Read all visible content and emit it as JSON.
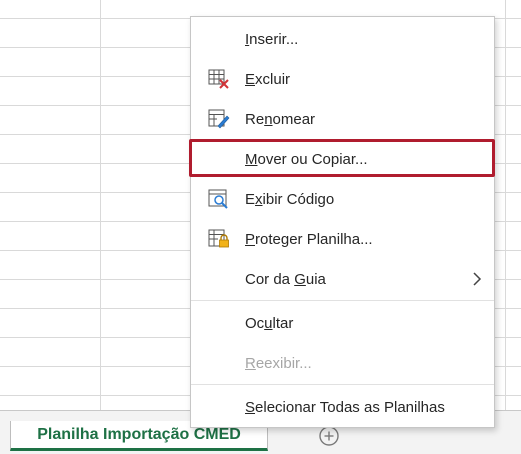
{
  "sheet_tab": {
    "label": "Planilha Importação CMED",
    "accent_color": "#1e7145"
  },
  "add_sheet_icon": "plus-circle-icon",
  "menu": {
    "items": [
      {
        "label_pre": "",
        "label_key": "I",
        "label_post": "nserir...",
        "icon": ""
      },
      {
        "label_pre": "",
        "label_key": "E",
        "label_post": "xcluir",
        "icon": "delete-sheet-icon"
      },
      {
        "label_pre": "Re",
        "label_key": "n",
        "label_post": "omear",
        "icon": "rename-sheet-icon"
      },
      {
        "label_pre": "",
        "label_key": "M",
        "label_post": "over ou Copiar...",
        "icon": ""
      },
      {
        "label_pre": "E",
        "label_key": "x",
        "label_post": "ibir Código",
        "icon": "view-code-icon"
      },
      {
        "label_pre": "",
        "label_key": "P",
        "label_post": "roteger Planilha...",
        "icon": "protect-sheet-icon"
      },
      {
        "label_pre": "Cor da ",
        "label_key": "G",
        "label_post": "uia",
        "icon": ""
      },
      {
        "label_pre": "Oc",
        "label_key": "u",
        "label_post": "ltar",
        "icon": ""
      },
      {
        "label_pre": "",
        "label_key": "R",
        "label_post": "eexibir...",
        "icon": ""
      },
      {
        "label_pre": "",
        "label_key": "S",
        "label_post": "elecionar Todas as Planilhas",
        "icon": ""
      }
    ],
    "highlight_color": "#b01c2e"
  }
}
